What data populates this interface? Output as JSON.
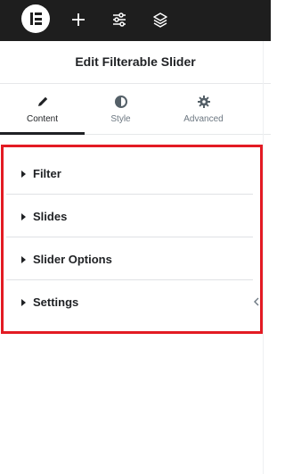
{
  "topbar": {
    "logo": "elementor-logo",
    "icons": [
      "plus-icon",
      "sliders-icon",
      "layers-icon"
    ]
  },
  "header": {
    "title": "Edit Filterable Slider"
  },
  "tabs": [
    {
      "label": "Content",
      "icon": "pencil-icon",
      "active": true
    },
    {
      "label": "Style",
      "icon": "half-circle-icon",
      "active": false
    },
    {
      "label": "Advanced",
      "icon": "gear-icon",
      "active": false
    }
  ],
  "sections": [
    {
      "label": "Filter"
    },
    {
      "label": "Slides"
    },
    {
      "label": "Slider Options"
    },
    {
      "label": "Settings"
    }
  ],
  "colors": {
    "topbar": "#1e1e1e",
    "highlight_border": "#e31b23",
    "text": "#1f2124",
    "muted_text": "#6d7882"
  }
}
